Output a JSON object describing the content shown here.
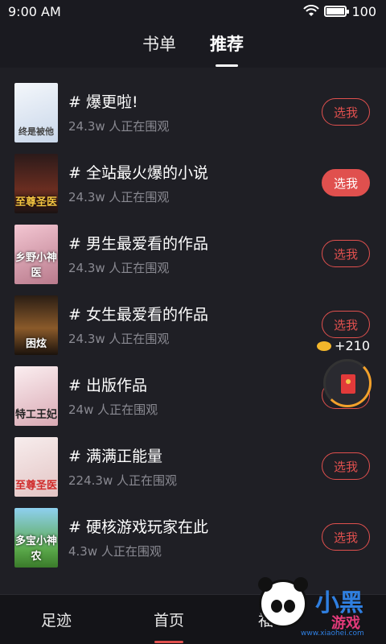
{
  "status_bar": {
    "time": "9:00 AM",
    "battery": "100",
    "battery_level": 1.0
  },
  "top_tabs": [
    {
      "label": "书单",
      "active": false
    },
    {
      "label": "推荐",
      "active": true
    }
  ],
  "books": [
    {
      "title": "# 爆更啦!",
      "viewers": "24.3w 人正在围观",
      "button": "选我",
      "button_filled": false,
      "cover_color": "#dfe7f2",
      "cover_text": "终是被他"
    },
    {
      "title": "# 全站最火爆的小说",
      "viewers": "24.3w 人正在围观",
      "button": "选我",
      "button_filled": true,
      "cover_color": "#4a2323",
      "cover_text": "至尊圣医"
    },
    {
      "title": "# 男生最爱看的作品",
      "viewers": "24.3w 人正在围观",
      "button": "选我",
      "button_filled": false,
      "cover_color": "#e9a7b8",
      "cover_text": "乡野小神医"
    },
    {
      "title": "# 女生最爱看的作品",
      "viewers": "24.3w 人正在围观",
      "button": "选我",
      "button_filled": false,
      "cover_color": "#6b4a2a",
      "cover_text": "困炫"
    },
    {
      "title": "# 出版作品",
      "viewers": "24w 人正在围观",
      "button": "选我",
      "button_filled": false,
      "cover_color": "#f0d4d8",
      "cover_text": "特工王妃"
    },
    {
      "title": "# 满满正能量",
      "viewers": "224.3w 人正在围观",
      "button": "选我",
      "button_filled": false,
      "cover_color": "#f3e4e4",
      "cover_text": "至尊圣医"
    },
    {
      "title": "# 硬核游戏玩家在此",
      "viewers": "4.3w 人正在围观",
      "button": "选我",
      "button_filled": false,
      "cover_color": "#7cc3e6",
      "cover_text": "多宝小神农"
    }
  ],
  "coin_reward": "+210",
  "bottom_nav": [
    {
      "label": "足迹",
      "active": false
    },
    {
      "label": "首页",
      "active": true
    },
    {
      "label": "福利",
      "active": false
    }
  ],
  "watermark": {
    "text": "小黑",
    "text2": "游戏",
    "url": "www.xiaohei.com"
  },
  "colors": {
    "accent": "#e0504e",
    "background": "#1f1f25"
  }
}
